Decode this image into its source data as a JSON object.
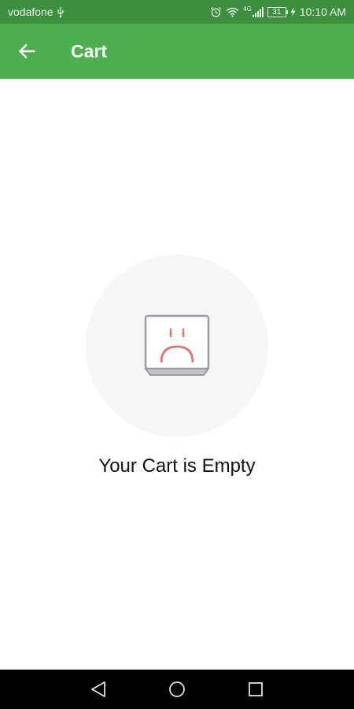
{
  "status_bar": {
    "carrier": "vodafone",
    "network_type": "4G",
    "battery": "31",
    "time": "10:10 AM",
    "icons": [
      "usb-icon",
      "alarm-icon",
      "wifi-icon",
      "signal-icon",
      "battery-icon",
      "charging-icon"
    ]
  },
  "app_bar": {
    "title": "Cart",
    "back_icon": "arrow-left-icon",
    "background_color": "#4caf50"
  },
  "empty_state": {
    "icon": "sad-box-icon",
    "message": "Your Cart is Empty"
  },
  "nav_bar": {
    "buttons": [
      "back-triangle-icon",
      "home-circle-icon",
      "recents-square-icon"
    ]
  }
}
